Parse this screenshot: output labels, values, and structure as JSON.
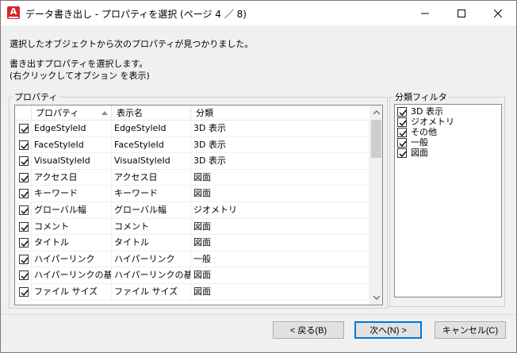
{
  "window": {
    "title": "データ書き出し - プロパティを選択 (ページ 4 ／ 8)",
    "app_icon_letter": "A"
  },
  "description": {
    "line1": "選択したオブジェクトから次のプロパティが見つかりました。",
    "line2": "書き出すプロパティを選択します。",
    "line3": "(右クリックしてオプション を表示)"
  },
  "properties_group": {
    "legend": "プロパティ",
    "columns": [
      "プロパティ",
      "表示名",
      "分類"
    ],
    "rows": [
      {
        "checked": true,
        "property": "EdgeStyleId",
        "display": "EdgeStyleId",
        "category": "3D 表示"
      },
      {
        "checked": true,
        "property": "FaceStyleId",
        "display": "FaceStyleId",
        "category": "3D 表示"
      },
      {
        "checked": true,
        "property": "VisualStyleId",
        "display": "VisualStyleId",
        "category": "3D 表示"
      },
      {
        "checked": true,
        "property": "アクセス日",
        "display": "アクセス日",
        "category": "図面"
      },
      {
        "checked": true,
        "property": "キーワード",
        "display": "キーワード",
        "category": "図面"
      },
      {
        "checked": true,
        "property": "グローバル幅",
        "display": "グローバル幅",
        "category": "ジオメトリ"
      },
      {
        "checked": true,
        "property": "コメント",
        "display": "コメント",
        "category": "図面"
      },
      {
        "checked": true,
        "property": "タイトル",
        "display": "タイトル",
        "category": "図面"
      },
      {
        "checked": true,
        "property": "ハイパーリンク",
        "display": "ハイパーリンク",
        "category": "一般"
      },
      {
        "checked": true,
        "property": "ハイパーリンクの基...",
        "display": "ハイパーリンクの基...",
        "category": "図面"
      },
      {
        "checked": true,
        "property": "ファイル サイズ",
        "display": "ファイル サイズ",
        "category": "図面"
      }
    ]
  },
  "filter_group": {
    "legend": "分類フィルタ",
    "items": [
      {
        "checked": true,
        "label": "3D 表示"
      },
      {
        "checked": true,
        "label": "ジオメトリ"
      },
      {
        "checked": true,
        "label": "その他"
      },
      {
        "checked": true,
        "label": "一般"
      },
      {
        "checked": true,
        "label": "図面"
      }
    ]
  },
  "buttons": {
    "back": "< 戻る(B)",
    "next": "次へ(N) >",
    "cancel": "キャンセル(C)"
  },
  "colors": {
    "accent": "#0078d7",
    "app_icon": "#d7262e"
  }
}
